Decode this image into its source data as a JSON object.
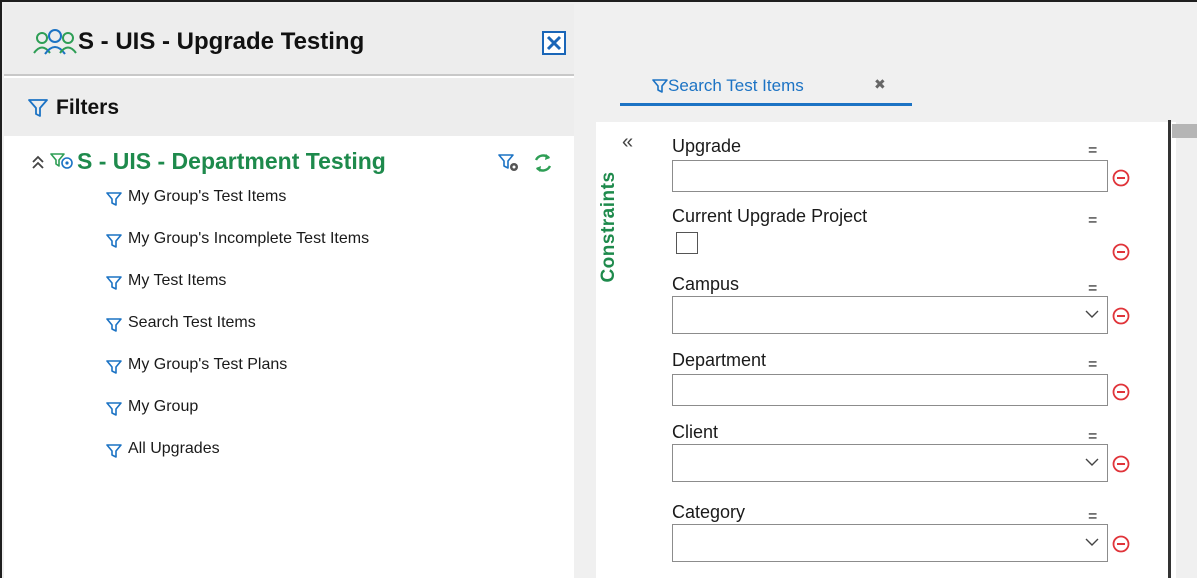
{
  "app": {
    "title": "S - UIS - Upgrade Testing",
    "icon": "group-users-icon",
    "close_icon": "close-box-icon"
  },
  "filters": {
    "title": "Filters",
    "root": {
      "label": "S - UIS - Department Testing",
      "collapse_icon": "double-chevron-up-icon",
      "actions": [
        "filter-settings-icon",
        "refresh-icon"
      ]
    },
    "items": [
      {
        "label": "My Group's Test Items"
      },
      {
        "label": "My Group's Incomplete Test Items"
      },
      {
        "label": "My Test Items"
      },
      {
        "label": "Search Test Items"
      },
      {
        "label": "My Group's Test Plans"
      },
      {
        "label": "My Group"
      },
      {
        "label": "All Upgrades"
      }
    ]
  },
  "tab": {
    "label": "Search Test Items",
    "close": "✖"
  },
  "constraints": {
    "title": "Constraints",
    "collapse": "«",
    "fields": [
      {
        "label": "Upgrade",
        "operator": "=",
        "kind": "text",
        "value": ""
      },
      {
        "label": "Current Upgrade Project",
        "operator": "=",
        "kind": "checkbox",
        "checked": false
      },
      {
        "label": "Campus",
        "operator": "=",
        "kind": "select",
        "value": ""
      },
      {
        "label": "Department",
        "operator": "=",
        "kind": "text",
        "value": ""
      },
      {
        "label": "Client",
        "operator": "=",
        "kind": "select",
        "value": ""
      },
      {
        "label": "Category",
        "operator": "=",
        "kind": "select",
        "value": ""
      }
    ]
  },
  "colors": {
    "accent_blue": "#1c73c4",
    "group_green": "#1e8a4c",
    "remove_red": "#e0343a"
  }
}
